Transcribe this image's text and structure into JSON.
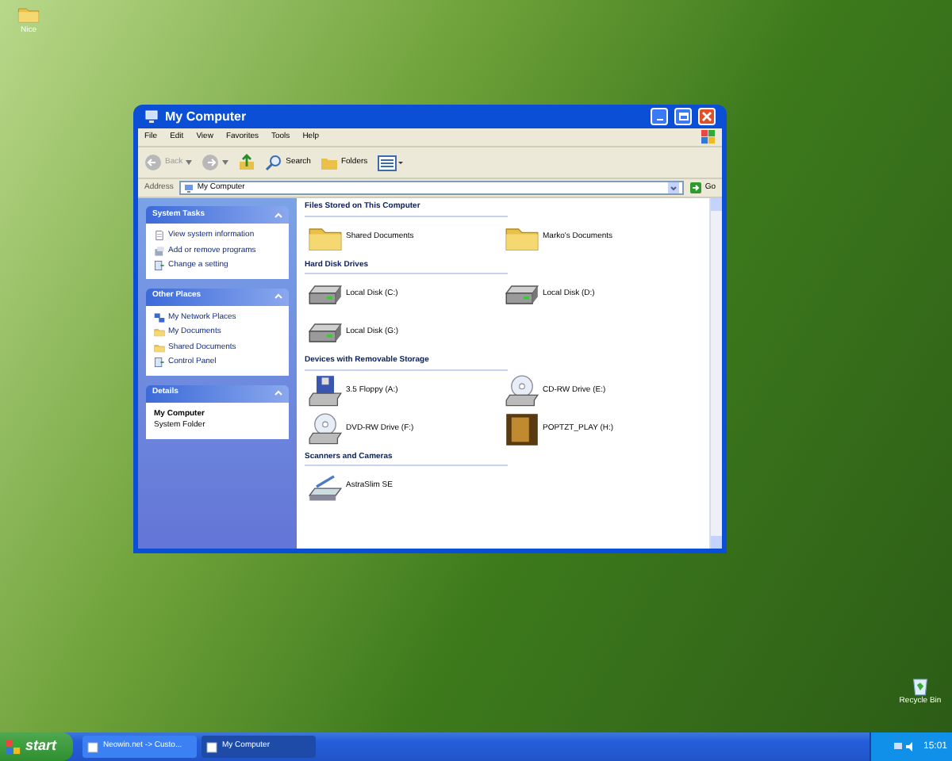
{
  "desktop_icons": [
    {
      "label": "Nice",
      "kind": "folder"
    },
    {
      "label": "Recycle Bin",
      "kind": "recycle"
    }
  ],
  "window": {
    "title": "My Computer"
  },
  "menu": [
    "File",
    "Edit",
    "View",
    "Favorites",
    "Tools",
    "Help"
  ],
  "toolbar": [
    {
      "label": "Back",
      "kind": "back",
      "disabled": true
    },
    {
      "kind": "forward",
      "disabled": true
    },
    {
      "kind": "up"
    },
    {
      "label": "Search",
      "kind": "search"
    },
    {
      "label": "Folders",
      "kind": "folders"
    },
    {
      "kind": "views"
    }
  ],
  "address": {
    "label": "Address",
    "value": "My Computer",
    "go": "Go"
  },
  "task_panes": [
    {
      "title": "System Tasks",
      "kind": "links",
      "items": [
        {
          "label": "View system information"
        },
        {
          "label": "Add or remove programs"
        },
        {
          "label": "Change a setting"
        }
      ]
    },
    {
      "title": "Other Places",
      "kind": "links",
      "items": [
        {
          "label": "My Network Places"
        },
        {
          "label": "My Documents"
        },
        {
          "label": "Shared Documents"
        },
        {
          "label": "Control Panel"
        }
      ]
    },
    {
      "title": "Details",
      "kind": "details",
      "name": "My Computer",
      "subtitle": "System Folder"
    }
  ],
  "groups": [
    {
      "title": "Files Stored on This Computer",
      "items": [
        {
          "label": "Shared Documents",
          "kind": "folder"
        },
        {
          "label": "Marko's Documents",
          "kind": "folder"
        }
      ]
    },
    {
      "title": "Hard Disk Drives",
      "items": [
        {
          "label": "Local Disk (C:)",
          "kind": "disk"
        },
        {
          "label": "Local Disk (D:)",
          "kind": "disk"
        },
        {
          "label": "Local Disk (G:)",
          "kind": "disk"
        }
      ]
    },
    {
      "title": "Devices with Removable Storage",
      "items": [
        {
          "label": "3.5 Floppy (A:)",
          "kind": "floppy"
        },
        {
          "label": "CD-RW Drive (E:)",
          "kind": "cd"
        },
        {
          "label": "DVD-RW Drive (F:)",
          "kind": "cd"
        },
        {
          "label": "POPTZT_PLAY (H:)",
          "kind": "picture"
        }
      ]
    },
    {
      "title": "Scanners and Cameras",
      "items": [
        {
          "label": "AstraSlim SE",
          "kind": "scanner"
        }
      ]
    }
  ],
  "taskbar": {
    "start": "start",
    "tasks": [
      {
        "label": "Neowin.net -> Custo...",
        "selected": false
      },
      {
        "label": "My Computer",
        "selected": true
      }
    ],
    "clock": "15:01"
  }
}
